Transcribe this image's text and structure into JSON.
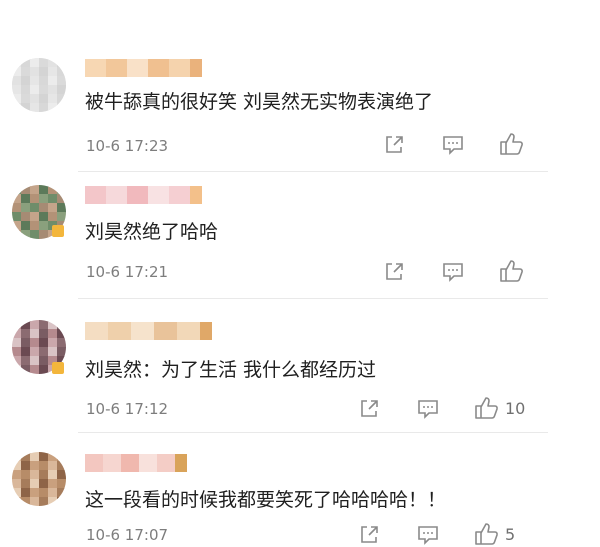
{
  "comments": [
    {
      "text": "被牛舔真的很好笑 刘昊然无实物表演绝了",
      "time": "10-6 17:23",
      "likes": "",
      "avatar_colors": [
        "#e6e6e6",
        "#d8d8d8",
        "#ececec",
        "#dadada",
        "#e2e2e2",
        "#d4d4d4"
      ],
      "name_colors": [
        "#f7d7b3",
        "#f2c79a",
        "#f9e1c8",
        "#f0c090",
        "#f5d3ad",
        "#eab27c"
      ]
    },
    {
      "text": "刘昊然绝了哈哈",
      "time": "10-6 17:21",
      "likes": "",
      "avatar_colors": [
        "#6f8d6a",
        "#a68b74",
        "#c4a48a",
        "#5c7a5a",
        "#b39277",
        "#8aa07d"
      ],
      "name_colors": [
        "#f3c6c9",
        "#f6d9db",
        "#f1b9bd",
        "#f8e2e3",
        "#f5cfd2",
        "#f3c08a"
      ]
    },
    {
      "text": "刘昊然：为了生活 我什么都经历过",
      "time": "10-6 17:12",
      "likes": "10",
      "avatar_colors": [
        "#b58a8e",
        "#6b4a52",
        "#caa7ab",
        "#8b6b71",
        "#d9c3c5",
        "#7a5c63"
      ],
      "name_colors": [
        "#f4ddc2",
        "#efd0ab",
        "#f6e3cc",
        "#e9c39a",
        "#f2d8b8",
        "#e0a868"
      ]
    },
    {
      "text": "这一段看的时候我都要笑死了哈哈哈哈！！",
      "time": "10-6 17:07",
      "likes": "5",
      "avatar_colors": [
        "#d9b79a",
        "#a67c5b",
        "#e6cdb4",
        "#8e6447",
        "#c9a07e",
        "#b78c68"
      ],
      "name_colors": [
        "#f3c7c0",
        "#f6d6d0",
        "#f0b8ae",
        "#f8e1dc",
        "#f4cdc6",
        "#d9a35a"
      ]
    }
  ],
  "icons": [
    "share-icon",
    "comment-icon",
    "like-icon"
  ]
}
